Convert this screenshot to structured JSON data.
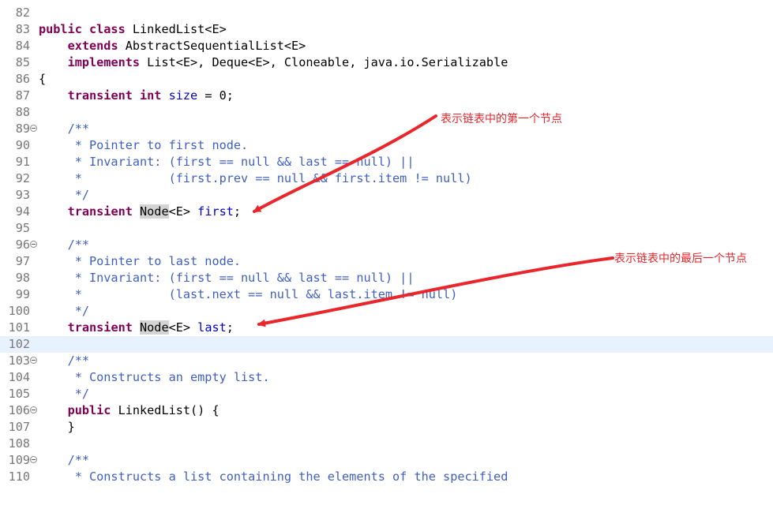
{
  "editor": {
    "lines": [
      {
        "num": "82",
        "fold": "",
        "tokens": []
      },
      {
        "num": "83",
        "fold": "",
        "tokens": [
          {
            "t": "kw",
            "v": "public class "
          },
          {
            "t": "plain",
            "v": "LinkedList<E>"
          }
        ]
      },
      {
        "num": "84",
        "fold": "",
        "tokens": [
          {
            "t": "plain",
            "v": "    "
          },
          {
            "t": "kw",
            "v": "extends "
          },
          {
            "t": "plain",
            "v": "AbstractSequentialList<E>"
          }
        ]
      },
      {
        "num": "85",
        "fold": "",
        "tokens": [
          {
            "t": "plain",
            "v": "    "
          },
          {
            "t": "kw",
            "v": "implements "
          },
          {
            "t": "plain",
            "v": "List<E>, Deque<E>, Cloneable, java.io.Serializable"
          }
        ]
      },
      {
        "num": "86",
        "fold": "",
        "tokens": [
          {
            "t": "plain",
            "v": "{"
          }
        ]
      },
      {
        "num": "87",
        "fold": "",
        "tokens": [
          {
            "t": "plain",
            "v": "    "
          },
          {
            "t": "kw",
            "v": "transient int "
          },
          {
            "t": "field",
            "v": "size"
          },
          {
            "t": "plain",
            "v": " = 0;"
          }
        ]
      },
      {
        "num": "88",
        "fold": "",
        "tokens": []
      },
      {
        "num": "89",
        "fold": "⊖",
        "tokens": [
          {
            "t": "doc",
            "v": "    /**"
          }
        ]
      },
      {
        "num": "90",
        "fold": "",
        "tokens": [
          {
            "t": "doc",
            "v": "     * Pointer to first node."
          }
        ]
      },
      {
        "num": "91",
        "fold": "",
        "tokens": [
          {
            "t": "doc",
            "v": "     * Invariant: (first == null && last == null) ||"
          }
        ]
      },
      {
        "num": "92",
        "fold": "",
        "tokens": [
          {
            "t": "doc",
            "v": "     *            (first.prev == null && first.item != null)"
          }
        ]
      },
      {
        "num": "93",
        "fold": "",
        "tokens": [
          {
            "t": "doc",
            "v": "     */"
          }
        ]
      },
      {
        "num": "94",
        "fold": "",
        "tokens": [
          {
            "t": "plain",
            "v": "    "
          },
          {
            "t": "kw",
            "v": "transient "
          },
          {
            "t": "hl",
            "v": "Node"
          },
          {
            "t": "plain",
            "v": "<E> "
          },
          {
            "t": "field",
            "v": "first"
          },
          {
            "t": "plain",
            "v": ";"
          }
        ]
      },
      {
        "num": "95",
        "fold": "",
        "tokens": []
      },
      {
        "num": "96",
        "fold": "⊖",
        "tokens": [
          {
            "t": "doc",
            "v": "    /**"
          }
        ]
      },
      {
        "num": "97",
        "fold": "",
        "tokens": [
          {
            "t": "doc",
            "v": "     * Pointer to last node."
          }
        ]
      },
      {
        "num": "98",
        "fold": "",
        "tokens": [
          {
            "t": "doc",
            "v": "     * Invariant: (first == null && last == null) ||"
          }
        ]
      },
      {
        "num": "99",
        "fold": "",
        "tokens": [
          {
            "t": "doc",
            "v": "     *            (last.next == null && last.item != null)"
          }
        ]
      },
      {
        "num": "100",
        "fold": "",
        "tokens": [
          {
            "t": "doc",
            "v": "     */"
          }
        ]
      },
      {
        "num": "101",
        "fold": "",
        "tokens": [
          {
            "t": "plain",
            "v": "    "
          },
          {
            "t": "kw",
            "v": "transient "
          },
          {
            "t": "hl",
            "v": "Node"
          },
          {
            "t": "plain",
            "v": "<E> "
          },
          {
            "t": "field",
            "v": "last"
          },
          {
            "t": "plain",
            "v": ";"
          }
        ]
      },
      {
        "num": "102",
        "fold": "",
        "current": true,
        "tokens": []
      },
      {
        "num": "103",
        "fold": "⊖",
        "tokens": [
          {
            "t": "doc",
            "v": "    /**"
          }
        ]
      },
      {
        "num": "104",
        "fold": "",
        "tokens": [
          {
            "t": "doc",
            "v": "     * Constructs an empty list."
          }
        ]
      },
      {
        "num": "105",
        "fold": "",
        "tokens": [
          {
            "t": "doc",
            "v": "     */"
          }
        ]
      },
      {
        "num": "106",
        "fold": "⊖",
        "tokens": [
          {
            "t": "plain",
            "v": "    "
          },
          {
            "t": "kw",
            "v": "public "
          },
          {
            "t": "plain",
            "v": "LinkedList() {"
          }
        ]
      },
      {
        "num": "107",
        "fold": "",
        "tokens": [
          {
            "t": "plain",
            "v": "    }"
          }
        ]
      },
      {
        "num": "108",
        "fold": "",
        "tokens": []
      },
      {
        "num": "109",
        "fold": "⊖",
        "tokens": [
          {
            "t": "doc",
            "v": "    /**"
          }
        ]
      },
      {
        "num": "110",
        "fold": "",
        "tokens": [
          {
            "t": "doc",
            "v": "     * Constructs a list containing the elements of the specified"
          }
        ]
      }
    ]
  },
  "annotations": {
    "first_note": "表示链表中的第一个节点",
    "last_note": "表示链表中的最后一个节点",
    "color": "#e8262b"
  }
}
